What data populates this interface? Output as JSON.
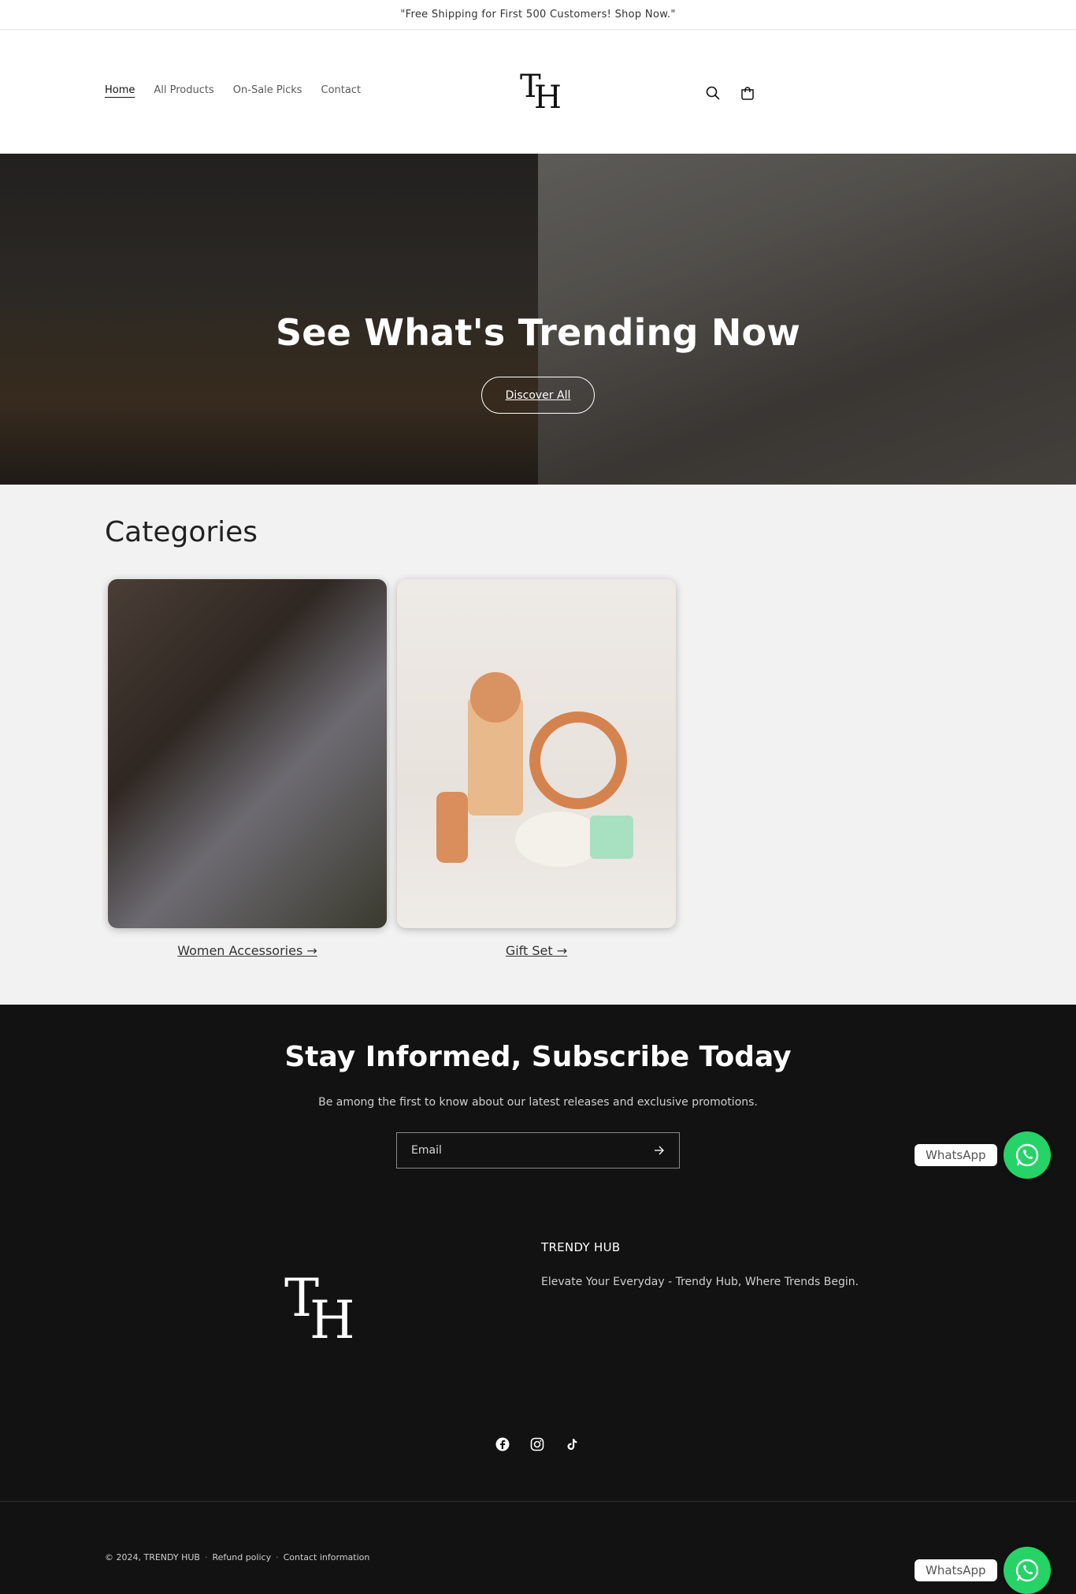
{
  "announcement": {
    "text": "\"Free Shipping for First 500 Customers! Shop Now.\""
  },
  "header": {
    "nav": [
      {
        "label": "Home",
        "active": true
      },
      {
        "label": "All Products",
        "active": false
      },
      {
        "label": "On-Sale Picks",
        "active": false
      },
      {
        "label": "Contact",
        "active": false
      }
    ],
    "logo_text": "TRENDY HUB",
    "icons": [
      "search-icon",
      "cart-icon"
    ]
  },
  "hero": {
    "title": "See What's Trending Now",
    "button_label": "Discover All"
  },
  "categories": {
    "title": "Categories",
    "items": [
      {
        "label": "Women Accessories →"
      },
      {
        "label": "Gift Set →"
      }
    ]
  },
  "newsletter": {
    "title": "Stay Informed, Subscribe Today",
    "description": "Be among the first to know about our latest releases and exclusive promotions.",
    "email_placeholder": "Email"
  },
  "footer": {
    "brand_title": "TRENDY HUB",
    "tagline": "Elevate Your Everyday - Trendy Hub, Where Trends Begin.",
    "logo_text": "TRENDY HUB",
    "socials": [
      "facebook-icon",
      "instagram-icon",
      "tiktok-icon"
    ],
    "copyright": "© 2024, TRENDY HUB",
    "links": [
      "Refund policy",
      "Contact information"
    ],
    "separator": "·"
  },
  "whatsapp": {
    "label": "WhatsApp"
  },
  "colors": {
    "accent_whatsapp": "#25d366",
    "footer_bg": "#121212",
    "categories_bg": "#f2f2f2"
  }
}
